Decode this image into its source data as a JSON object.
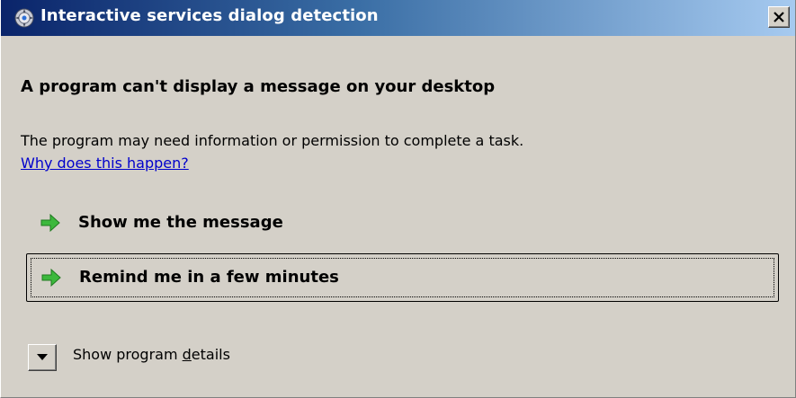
{
  "window": {
    "title": "Interactive services dialog detection",
    "icon": "services-gear-icon",
    "close_icon": "close-icon",
    "titlebar_color_start": "#0a246a",
    "titlebar_color_end": "#a6caf0"
  },
  "main": {
    "heading": "A program can't display a message on your desktop",
    "description": "The program may need information or permission to complete a task.",
    "link": "Why does this happen?",
    "link_color": "#0000cc"
  },
  "commands": [
    {
      "label": "Show me the message",
      "icon": "green-arrow-icon",
      "focused": false
    },
    {
      "label": "Remind me in a few minutes",
      "icon": "green-arrow-icon",
      "focused": true
    }
  ],
  "details": {
    "label_prefix": "Show program ",
    "label_accel": "d",
    "label_suffix": "etails",
    "icon": "chevron-down-icon"
  },
  "colors": {
    "arrow_green": "#3cb83c",
    "dialog_background": "#d4d0c8"
  }
}
